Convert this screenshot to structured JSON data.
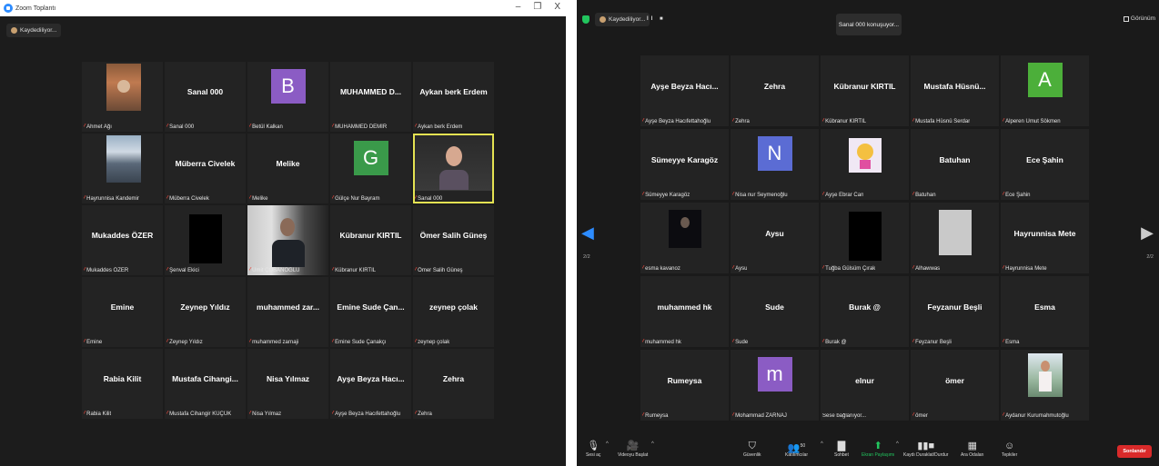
{
  "left_window": {
    "title": "Zoom Toplantı",
    "controls": [
      "–",
      "❐",
      "X"
    ],
    "recording_label": "Kaydediliyor...",
    "tiles": [
      {
        "name": "",
        "label": "Ahmet Ağı",
        "kind": "photo",
        "photo": "room"
      },
      {
        "name": "Sanal 000",
        "label": "Sanal 000"
      },
      {
        "name": "",
        "label": "Betül Kalkan",
        "kind": "avatar",
        "letter": "B",
        "color": "#8b5cc4"
      },
      {
        "name": "MUHAMMED D...",
        "label": "MUHAMMED DEMİR"
      },
      {
        "name": "Aykan berk Erdem",
        "label": "Aykan berk Erdem"
      },
      {
        "name": "",
        "label": "Hayrunnisa Kandemir",
        "kind": "photo",
        "photo": "city"
      },
      {
        "name": "Müberra Civelek",
        "label": "Müberra Civelek"
      },
      {
        "name": "Melike",
        "label": "Melike"
      },
      {
        "name": "",
        "label": "Gülçe Nur Bayram",
        "kind": "avatar",
        "letter": "G",
        "color": "#3a9a4a"
      },
      {
        "name": "",
        "label": "Sanal 000",
        "kind": "photo",
        "photo": "woman",
        "active": true
      },
      {
        "name": "Mukaddes ÖZER",
        "label": "Mukaddes ÖZER"
      },
      {
        "name": "",
        "label": "Şenval Ekici",
        "kind": "black"
      },
      {
        "name": "",
        "label": "Ümit ÇOBANOĞLU",
        "kind": "photo",
        "photo": "man"
      },
      {
        "name": "Kübranur KIRTIL",
        "label": "Kübranur KIRTIL"
      },
      {
        "name": "Ömer Salih Güneş",
        "label": "Ömer Salih Güneş"
      },
      {
        "name": "Emine",
        "label": "Emine"
      },
      {
        "name": "Zeynep Yıldız",
        "label": "Zeynep Yıldız"
      },
      {
        "name": "muhammed zar...",
        "label": "muhammed zarnaji"
      },
      {
        "name": "Emine Sude Çan...",
        "label": "Emine Sude Çanakçı"
      },
      {
        "name": "zeynep çolak",
        "label": "zeynep çolak"
      },
      {
        "name": "Rabia Kilit",
        "label": "Rabia Kilit"
      },
      {
        "name": "Mustafa Cihangi...",
        "label": "Mustafa Cihangir KÜÇÜK"
      },
      {
        "name": "Nisa Yılmaz",
        "label": "Nisa Yılmaz"
      },
      {
        "name": "Ayşe Beyza Hacı...",
        "label": "Ayşe Beyza Hacıfettahoğlu"
      },
      {
        "name": "Zehra",
        "label": "Zehra"
      }
    ]
  },
  "right_window": {
    "recording_label": "Kaydediliyor...",
    "recording_controls": "II ■",
    "speaker_label": "Sanal 000 konuşuyor...",
    "view_label": "Görünüm",
    "page_left": "2/2",
    "page_right": "2/2",
    "tiles": [
      {
        "name": "Ayşe Beyza Hacı...",
        "label": "Ayşe Beyza Hacıfettahoğlu"
      },
      {
        "name": "Zehra",
        "label": "Zehra"
      },
      {
        "name": "Kübranur KIRTIL",
        "label": "Kübranur KIRTIL"
      },
      {
        "name": "Mustafa Hüsnü...",
        "label": "Mustafa Hüsnü Serdar"
      },
      {
        "name": "",
        "label": "Alperen Umut Sökmen",
        "kind": "avatar",
        "letter": "A",
        "color": "#4caf3a"
      },
      {
        "name": "Sümeyye Karagöz",
        "label": "Sümeyye Karagöz"
      },
      {
        "name": "",
        "label": "Nisa nur Seymenoğlu",
        "kind": "avatar",
        "letter": "N",
        "color": "#5b6cd4"
      },
      {
        "name": "",
        "label": "Ayşe Ebrar Can",
        "kind": "photo",
        "photo": "cartoon"
      },
      {
        "name": "Batuhan",
        "label": "Batuhan"
      },
      {
        "name": "Ece Şahin",
        "label": "Ece Şahin"
      },
      {
        "name": "",
        "label": "esma kavanoz",
        "kind": "photo",
        "photo": "dark"
      },
      {
        "name": "Aysu",
        "label": "Aysu"
      },
      {
        "name": "",
        "label": "Tuğba Gülsüm Çırak",
        "kind": "black"
      },
      {
        "name": "",
        "label": "Alhawwas",
        "kind": "grey"
      },
      {
        "name": "Hayrunnisa Mete",
        "label": "Hayrunnisa Mete"
      },
      {
        "name": "muhammed hk",
        "label": "muhammed hk"
      },
      {
        "name": "Sude",
        "label": "Sude"
      },
      {
        "name": "Burak @",
        "label": "Burak @"
      },
      {
        "name": "Feyzanur Beşli",
        "label": "Feyzanur Beşli"
      },
      {
        "name": "Esma",
        "label": "Esma"
      },
      {
        "name": "Rumeysa",
        "label": "Rumeysa"
      },
      {
        "name": "",
        "label": "Mohammad ZARNAJ",
        "kind": "avatar",
        "letter": "m",
        "color": "#8b5cc4"
      },
      {
        "name": "elnur",
        "label": "Sese bağlanıyor...",
        "no_mute": true
      },
      {
        "name": "ömer",
        "label": "ömer"
      },
      {
        "name": "",
        "label": "Aydanur Kurumahmutoğlu",
        "kind": "photo",
        "photo": "girl"
      }
    ],
    "toolbar": {
      "mute_label": "Sesi aç",
      "video_label": "Videoyu Başlat",
      "security_label": "Güvenlik",
      "participants_label": "Katılımcılar",
      "participants_count": "50",
      "chat_label": "Sohbet",
      "share_label": "Ekran Paylaşımı",
      "record_label": "Kaydı Duraklat/Durdur",
      "breakout_label": "Ara Odaları",
      "reactions_label": "Tepkiler",
      "end_label": "Sonlandır"
    }
  }
}
